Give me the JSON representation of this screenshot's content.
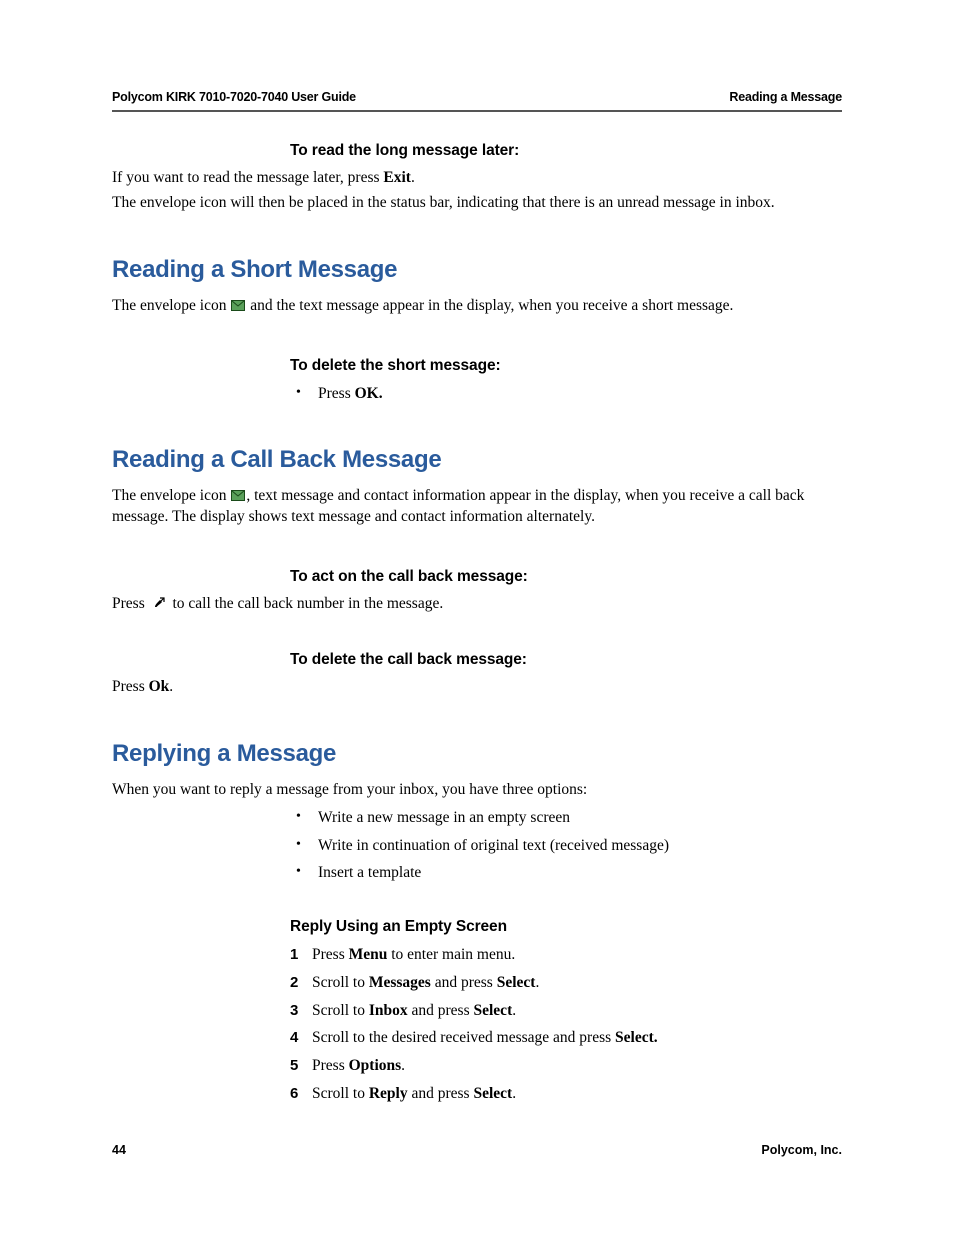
{
  "header": {
    "left": "Polycom KIRK 7010-7020-7040 User Guide",
    "right": "Reading a Message"
  },
  "s0": {
    "subhead": "To read the long message later:",
    "p1a": "If you want to read the message later, press ",
    "p1b": "Exit",
    "p1c": ".",
    "p2": "The envelope icon will then be placed in the status bar, indicating that there is an unread message in inbox."
  },
  "s1": {
    "title": "Reading a Short Message",
    "p1a": "The envelope icon ",
    "p1b": " and the text message appear in the display, when you receive a short message.",
    "sub1": "To delete the short message:",
    "b1a": "Press ",
    "b1b": "OK."
  },
  "s2": {
    "title": "Reading a Call Back Message",
    "p1a": "The envelope icon ",
    "p1b": ", text message and contact information appear in the display, when you receive a call back message. The display shows text message and contact information alternately.",
    "sub1": "To act on the call back message:",
    "p2a": "Press ",
    "p2b": " to call the call back number in the message.",
    "sub2": "To delete the call back message:",
    "p3a": "Press ",
    "p3b": "Ok",
    "p3c": "."
  },
  "s3": {
    "title": "Replying a Message",
    "p1": "When you want to reply a message from your inbox, you have three options:",
    "b1": "Write a new message in an empty screen",
    "b2": "Write in continuation of original text (received message)",
    "b3": "Insert a template",
    "sub1": "Reply Using an Empty Screen",
    "step1a": "Press ",
    "step1b": "Menu",
    "step1c": " to enter main menu.",
    "step2a": "Scroll to ",
    "step2b": "Messages",
    "step2c": " and press ",
    "step2d": "Select",
    "step2e": ".",
    "step3a": "Scroll to ",
    "step3b": "Inbox",
    "step3c": " and press ",
    "step3d": "Select",
    "step3e": ".",
    "step4a": "Scroll to the desired received message and press ",
    "step4b": "Select.",
    "step5a": "Press ",
    "step5b": "Options",
    "step5c": ".",
    "step6a": "Scroll to ",
    "step6b": "Reply",
    "step6c": " and press ",
    "step6d": "Select",
    "step6e": "."
  },
  "footer": {
    "page": "44",
    "company": "Polycom, Inc."
  }
}
